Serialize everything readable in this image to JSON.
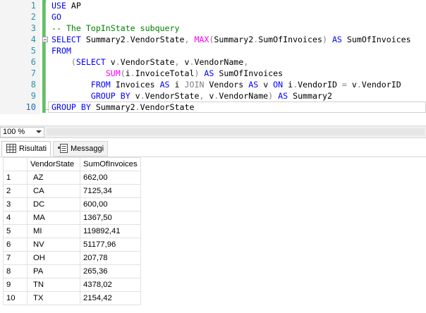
{
  "editor": {
    "line_numbers": [
      "1",
      "2",
      "3",
      "4",
      "5",
      "6",
      "7",
      "8",
      "9",
      "10"
    ],
    "lines": [
      [
        {
          "t": "USE",
          "c": "kw"
        },
        {
          "t": " AP",
          "c": ""
        }
      ],
      [
        {
          "t": "GO",
          "c": "kw"
        }
      ],
      [
        {
          "t": "-- The TopInState subquery",
          "c": "cm"
        }
      ],
      [
        {
          "t": "SELECT",
          "c": "kw"
        },
        {
          "t": " Summary2",
          "c": ""
        },
        {
          "t": ".",
          "c": "op"
        },
        {
          "t": "VendorState",
          "c": ""
        },
        {
          "t": ",",
          "c": "op"
        },
        {
          "t": " ",
          "c": ""
        },
        {
          "t": "MAX",
          "c": "fn"
        },
        {
          "t": "(",
          "c": "op"
        },
        {
          "t": "Summary2",
          "c": ""
        },
        {
          "t": ".",
          "c": "op"
        },
        {
          "t": "SumOfInvoices",
          "c": ""
        },
        {
          "t": ")",
          "c": "op"
        },
        {
          "t": " ",
          "c": ""
        },
        {
          "t": "AS",
          "c": "kw"
        },
        {
          "t": " SumOfInvoices",
          "c": ""
        }
      ],
      [
        {
          "t": "FROM",
          "c": "kw"
        }
      ],
      [
        {
          "t": "    ",
          "c": ""
        },
        {
          "t": "(",
          "c": "op"
        },
        {
          "t": "SELECT",
          "c": "kw"
        },
        {
          "t": " v",
          "c": ""
        },
        {
          "t": ".",
          "c": "op"
        },
        {
          "t": "VendorState",
          "c": ""
        },
        {
          "t": ",",
          "c": "op"
        },
        {
          "t": " v",
          "c": ""
        },
        {
          "t": ".",
          "c": "op"
        },
        {
          "t": "VendorName",
          "c": ""
        },
        {
          "t": ",",
          "c": "op"
        }
      ],
      [
        {
          "t": "           ",
          "c": ""
        },
        {
          "t": "SUM",
          "c": "fn"
        },
        {
          "t": "(",
          "c": "op"
        },
        {
          "t": "i",
          "c": ""
        },
        {
          "t": ".",
          "c": "op"
        },
        {
          "t": "InvoiceTotal",
          "c": ""
        },
        {
          "t": ")",
          "c": "op"
        },
        {
          "t": " ",
          "c": ""
        },
        {
          "t": "AS",
          "c": "kw"
        },
        {
          "t": " SumOfInvoices",
          "c": ""
        }
      ],
      [
        {
          "t": "        ",
          "c": ""
        },
        {
          "t": "FROM",
          "c": "kw"
        },
        {
          "t": " Invoices ",
          "c": ""
        },
        {
          "t": "AS",
          "c": "kw"
        },
        {
          "t": " i ",
          "c": ""
        },
        {
          "t": "JOIN",
          "c": "op"
        },
        {
          "t": " Vendors ",
          "c": ""
        },
        {
          "t": "AS",
          "c": "kw"
        },
        {
          "t": " v ",
          "c": ""
        },
        {
          "t": "ON",
          "c": "kw"
        },
        {
          "t": " i",
          "c": ""
        },
        {
          "t": ".",
          "c": "op"
        },
        {
          "t": "VendorID ",
          "c": ""
        },
        {
          "t": "=",
          "c": "op"
        },
        {
          "t": " v",
          "c": ""
        },
        {
          "t": ".",
          "c": "op"
        },
        {
          "t": "VendorID",
          "c": ""
        }
      ],
      [
        {
          "t": "        ",
          "c": ""
        },
        {
          "t": "GROUP BY",
          "c": "kw"
        },
        {
          "t": " v",
          "c": ""
        },
        {
          "t": ".",
          "c": "op"
        },
        {
          "t": "VendorState",
          "c": ""
        },
        {
          "t": ",",
          "c": "op"
        },
        {
          "t": " v",
          "c": ""
        },
        {
          "t": ".",
          "c": "op"
        },
        {
          "t": "VendorName",
          "c": ""
        },
        {
          "t": ")",
          "c": "op"
        },
        {
          "t": " ",
          "c": ""
        },
        {
          "t": "AS",
          "c": "kw"
        },
        {
          "t": " Summary2",
          "c": ""
        }
      ],
      [
        {
          "t": "GROUP BY",
          "c": "kw"
        },
        {
          "t": " Summary2",
          "c": ""
        },
        {
          "t": ".",
          "c": "op"
        },
        {
          "t": "VendorState",
          "c": ""
        }
      ]
    ]
  },
  "zoom": {
    "value": "100 %"
  },
  "tabs": {
    "results": "Risultati",
    "messages": "Messaggi"
  },
  "results": {
    "columns": [
      "VendorState",
      "SumOfInvoices"
    ],
    "rows": [
      {
        "n": "1",
        "state": "AZ",
        "sum": "662,00"
      },
      {
        "n": "2",
        "state": "CA",
        "sum": "7125,34"
      },
      {
        "n": "3",
        "state": "DC",
        "sum": "600,00"
      },
      {
        "n": "4",
        "state": "MA",
        "sum": "1367,50"
      },
      {
        "n": "5",
        "state": "MI",
        "sum": "119892,41"
      },
      {
        "n": "6",
        "state": "NV",
        "sum": "51177,96"
      },
      {
        "n": "7",
        "state": "OH",
        "sum": "207,78"
      },
      {
        "n": "8",
        "state": "PA",
        "sum": "265,36"
      },
      {
        "n": "9",
        "state": "TN",
        "sum": "4378,02"
      },
      {
        "n": "10",
        "state": "TX",
        "sum": "2154,42"
      }
    ]
  }
}
